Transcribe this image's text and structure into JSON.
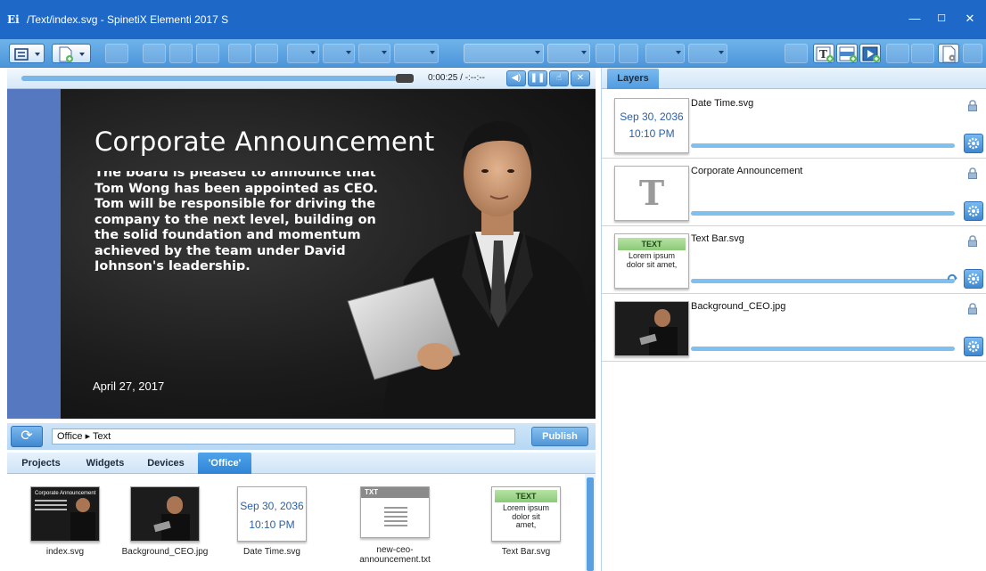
{
  "window": {
    "title": "/Text/index.svg - SpinetiX Elementi 2017 S",
    "controls": {
      "minimize": "—",
      "maximize": "☐",
      "close": "✕"
    }
  },
  "toolbar": {
    "icons": [
      "menu-icon",
      "new-document-icon",
      "save-icon",
      "cut-icon",
      "copy-icon",
      "paste-icon",
      "undo-icon",
      "redo-icon",
      "font-combo",
      "size-combo",
      "bold-icon",
      "italic-icon",
      "align-icon",
      "list-icon",
      "add-text-layer-icon",
      "add-text-bar-icon",
      "add-media-layer-icon",
      "document-settings-icon"
    ]
  },
  "player": {
    "time": "0:00:25 / -:--:--",
    "progress": 0.98,
    "buttons": {
      "volume": "◀)",
      "pause": "❚❚",
      "interactive": "☝",
      "close": "✕"
    }
  },
  "slide": {
    "title": "Corporate Announcement",
    "body": "The board is pleased to announce that Tom Wong has been appointed as CEO. Tom will be responsible for driving the company to the next level, building on the solid foundation and momentum achieved by the team under David Johnson's leadership.",
    "date": "April 27, 2017"
  },
  "address": {
    "path": "Office ▸ Text",
    "publish_label": "Publish"
  },
  "library": {
    "tabs": [
      "Projects",
      "Widgets",
      "Devices",
      "'Office'"
    ],
    "active_tab": "'Office'",
    "items": [
      {
        "name": "index.svg",
        "thumb_text": "Corporate Announcement"
      },
      {
        "name": "Background_CEO.jpg"
      },
      {
        "name": "Date Time.svg",
        "thumb_date": "Sep 30, 2036",
        "thumb_time": "10:10 PM"
      },
      {
        "name": "new-ceo-announcement.txt",
        "thumb_label": "TXT"
      },
      {
        "name": "Text Bar.svg",
        "thumb_head": "TEXT",
        "thumb_body": "Lorem ipsum dolor sit amet,"
      }
    ]
  },
  "layers": {
    "tab_label": "Layers",
    "items": [
      {
        "name": "Date Time.svg",
        "thumb_date": "Sep 30, 2036",
        "thumb_time": "10:10 PM"
      },
      {
        "name": "Corporate Announcement",
        "thumb_letter": "T"
      },
      {
        "name": "Text Bar.svg",
        "thumb_head": "TEXT",
        "thumb_body": "Lorem ipsum dolor sit amet,"
      },
      {
        "name": "Background_CEO.jpg"
      }
    ]
  },
  "colors": {
    "titlebar": "#1e69c7",
    "toolbar": "#5aa2e0",
    "accent": "#3f88d0",
    "canvas_bg": "#5578c0",
    "slide_bg": "#1c1c1c"
  }
}
